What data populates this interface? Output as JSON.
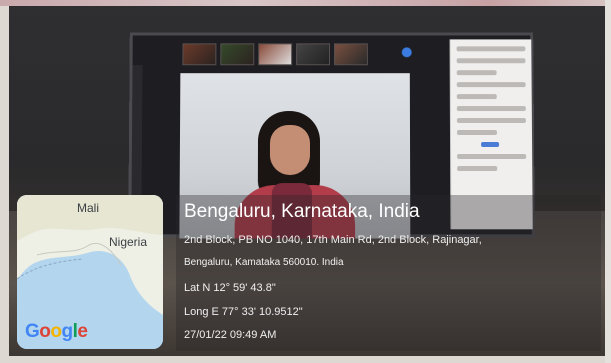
{
  "overlay": {
    "city": "Bengaluru, Karnataka, India",
    "address_line1": "2nd Block, PB NO 1040, 17th Main Rd, 2nd Block, Rajinagar,",
    "address_line2": "Bengaluru, Kamataka 560010. India",
    "latitude": "Lat N 12° 59' 43.8\"",
    "longitude": "Long E 77° 33' 10.9512\"",
    "datetime": "27/01/22 09:49 AM"
  },
  "map": {
    "labels": [
      "Mali",
      "Nigeria"
    ],
    "brand": "Google",
    "water_color": "#b3d6ee",
    "land_color": "#eef0e6"
  },
  "icons": {
    "video_call": "video-call-thumbnail-icon",
    "map": "map-icon",
    "brand_logo": "google-logo-icon"
  }
}
